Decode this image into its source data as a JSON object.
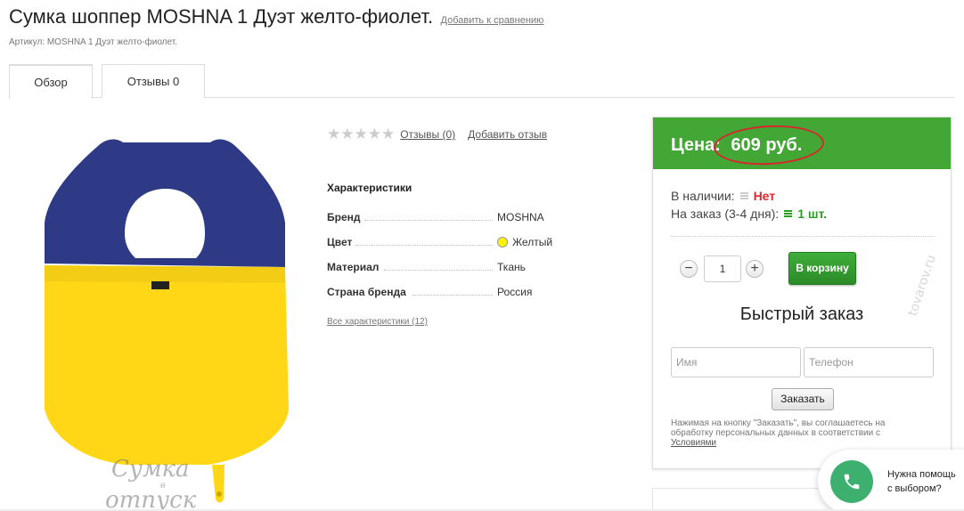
{
  "product": {
    "title": "Сумка шоппер MOSHNA 1 Дуэт желто-фиолет.",
    "compare_link": "Добавить к сравнению",
    "article": "Артикул: MOSHNA 1 Дуэт желто-фиолет.",
    "image_label": "MOSHNA",
    "watermark": "Сумка в отпуск"
  },
  "tabs": [
    {
      "label": "Обзор",
      "active": true
    },
    {
      "label": "Отзывы 0",
      "active": false
    }
  ],
  "rating": {
    "stars_filled": 0,
    "stars_total": 5,
    "reviews_link": "Отзывы (0)",
    "add_review_link": "Добавить отзыв"
  },
  "specs": {
    "title": "Характеристики",
    "rows": [
      {
        "label": "Бренд",
        "value": "MOSHNA"
      },
      {
        "label": "Цвет",
        "value": "Желтый",
        "swatch": "#fff200"
      },
      {
        "label": "Материал",
        "value": "Ткань"
      },
      {
        "label": "Страна бренда",
        "value": "Россия"
      }
    ],
    "all_link": "Все характеристики (12)"
  },
  "buy_box": {
    "price_label": "Цена:",
    "price_value": "609 руб.",
    "in_stock_label": "В наличии:",
    "in_stock_value": "Нет",
    "preorder_label": "На заказ (3-4 дня):",
    "preorder_value": "1 шт.",
    "quantity": "1",
    "minus_label": "−",
    "plus_label": "+",
    "cart_button": "В корзину",
    "side_watermark": "tovarov.ru",
    "colors": {
      "accent_green": "#43a735",
      "stock_no": "#e1262b",
      "stock_ok": "#2e9d27",
      "highlight_circle": "#d9262c"
    }
  },
  "quick_order": {
    "title": "Быстрый заказ",
    "name_placeholder": "Имя",
    "phone_placeholder": "Телефон",
    "submit_button": "Заказать",
    "consent_text": "Нажимая на кнопку \"Заказать\", вы соглашаетесь на обработку персональных данных в соответствии с",
    "consent_link": "Условиями"
  },
  "help_widget": {
    "line1": "Нужна помощь",
    "line2": "с выбором?",
    "icon": "phone-icon"
  }
}
